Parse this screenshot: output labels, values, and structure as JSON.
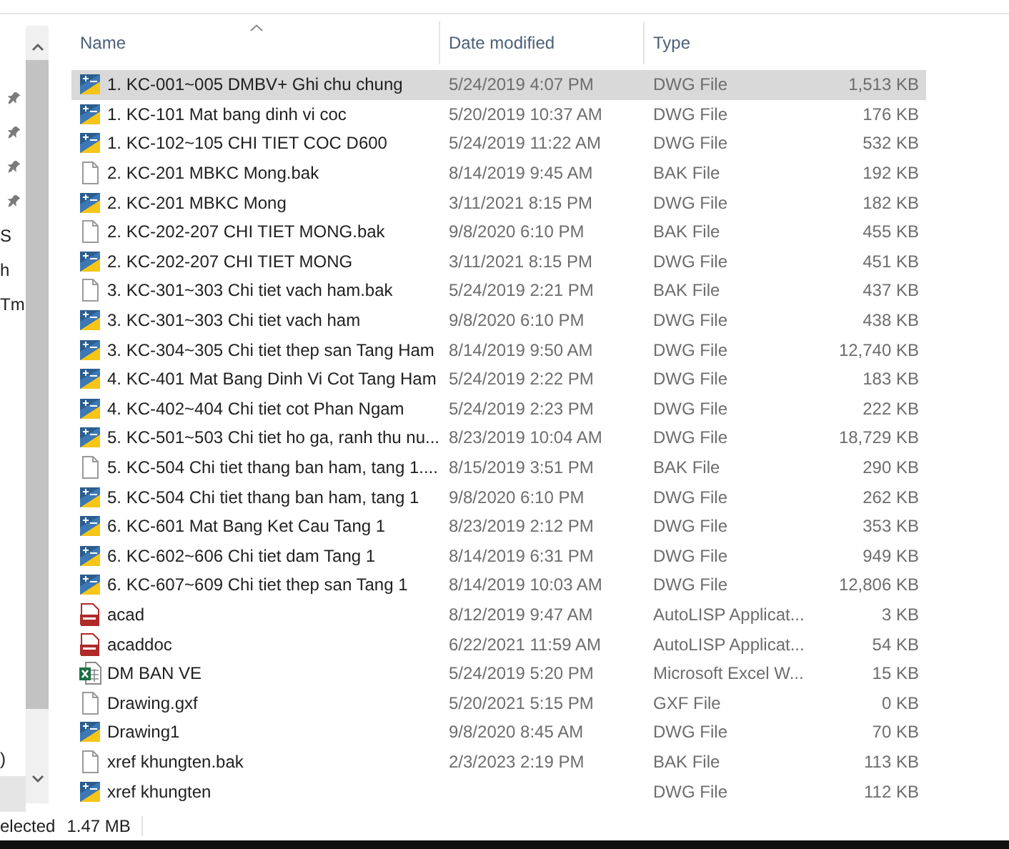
{
  "nav_items": [
    {
      "kind": "pin"
    },
    {
      "kind": "pin"
    },
    {
      "kind": "pin"
    },
    {
      "kind": "pin"
    },
    {
      "kind": "text",
      "label": "S"
    },
    {
      "kind": "text",
      "label": "h"
    },
    {
      "kind": "text",
      "label": "Tm"
    }
  ],
  "nav_items_bottom": [
    {
      "kind": "text",
      "label": ")"
    },
    {
      "kind": "highlight"
    }
  ],
  "table": {
    "columns": [
      {
        "label": "Name",
        "sorted": true
      },
      {
        "label": "Date modified",
        "sorted": false
      },
      {
        "label": "Type",
        "sorted": false
      }
    ],
    "rows": [
      {
        "kind": "dwg",
        "name": "1. KC-001~005 DMBV+ Ghi chu chung",
        "date": "5/24/2019 4:07 PM",
        "type": "DWG File",
        "size": "1,513 KB",
        "selected": true
      },
      {
        "kind": "dwg",
        "name": "1. KC-101 Mat bang dinh vi coc",
        "date": "5/20/2019 10:37 AM",
        "type": "DWG File",
        "size": "176 KB",
        "selected": false
      },
      {
        "kind": "dwg",
        "name": "1. KC-102~105 CHI TIET COC D600",
        "date": "5/24/2019 11:22 AM",
        "type": "DWG File",
        "size": "532 KB",
        "selected": false
      },
      {
        "kind": "doc",
        "name": "2. KC-201 MBKC Mong.bak",
        "date": "8/14/2019 9:45 AM",
        "type": "BAK File",
        "size": "192 KB",
        "selected": false
      },
      {
        "kind": "dwg",
        "name": "2. KC-201 MBKC Mong",
        "date": "3/11/2021 8:15 PM",
        "type": "DWG File",
        "size": "182 KB",
        "selected": false
      },
      {
        "kind": "doc",
        "name": "2. KC-202-207 CHI TIET MONG.bak",
        "date": "9/8/2020 6:10 PM",
        "type": "BAK File",
        "size": "455 KB",
        "selected": false
      },
      {
        "kind": "dwg",
        "name": "2. KC-202-207 CHI TIET MONG",
        "date": "3/11/2021 8:15 PM",
        "type": "DWG File",
        "size": "451 KB",
        "selected": false
      },
      {
        "kind": "doc",
        "name": "3. KC-301~303 Chi tiet vach ham.bak",
        "date": "5/24/2019 2:21 PM",
        "type": "BAK File",
        "size": "437 KB",
        "selected": false
      },
      {
        "kind": "dwg",
        "name": "3. KC-301~303 Chi tiet vach ham",
        "date": "9/8/2020 6:10 PM",
        "type": "DWG File",
        "size": "438 KB",
        "selected": false
      },
      {
        "kind": "dwg",
        "name": "3. KC-304~305 Chi tiet thep san Tang Ham",
        "date": "8/14/2019 9:50 AM",
        "type": "DWG File",
        "size": "12,740 KB",
        "selected": false
      },
      {
        "kind": "dwg",
        "name": "4. KC-401 Mat Bang Dinh Vi Cot Tang Ham",
        "date": "5/24/2019 2:22 PM",
        "type": "DWG File",
        "size": "183 KB",
        "selected": false
      },
      {
        "kind": "dwg",
        "name": "4. KC-402~404 Chi tiet cot Phan Ngam",
        "date": "5/24/2019 2:23 PM",
        "type": "DWG File",
        "size": "222 KB",
        "selected": false
      },
      {
        "kind": "dwg",
        "name": "5. KC-501~503 Chi tiet ho ga, ranh thu nu...",
        "date": "8/23/2019 10:04 AM",
        "type": "DWG File",
        "size": "18,729 KB",
        "selected": false
      },
      {
        "kind": "doc",
        "name": "5. KC-504 Chi tiet thang ban ham, tang 1....",
        "date": "8/15/2019 3:51 PM",
        "type": "BAK File",
        "size": "290 KB",
        "selected": false
      },
      {
        "kind": "dwg",
        "name": "5. KC-504 Chi tiet thang ban ham, tang 1",
        "date": "9/8/2020 6:10 PM",
        "type": "DWG File",
        "size": "262 KB",
        "selected": false
      },
      {
        "kind": "dwg",
        "name": "6. KC-601 Mat Bang Ket Cau Tang 1",
        "date": "8/23/2019 2:12 PM",
        "type": "DWG File",
        "size": "353 KB",
        "selected": false
      },
      {
        "kind": "dwg",
        "name": "6. KC-602~606 Chi tiet dam Tang 1",
        "date": "8/14/2019 6:31 PM",
        "type": "DWG File",
        "size": "949 KB",
        "selected": false
      },
      {
        "kind": "dwg",
        "name": "6. KC-607~609 Chi tiet thep san Tang 1",
        "date": "8/14/2019 10:03 AM",
        "type": "DWG File",
        "size": "12,806 KB",
        "selected": false
      },
      {
        "kind": "lsp",
        "name": "acad",
        "date": "8/12/2019 9:47 AM",
        "type": "AutoLISP Applicat...",
        "size": "3 KB",
        "selected": false
      },
      {
        "kind": "lsp",
        "name": "acaddoc",
        "date": "6/22/2021 11:59 AM",
        "type": "AutoLISP Applicat...",
        "size": "54 KB",
        "selected": false
      },
      {
        "kind": "xls",
        "name": "DM BAN VE",
        "date": "5/24/2019 5:20 PM",
        "type": "Microsoft Excel W...",
        "size": "15 KB",
        "selected": false
      },
      {
        "kind": "doc",
        "name": "Drawing.gxf",
        "date": "5/20/2021 5:15 PM",
        "type": "GXF File",
        "size": "0 KB",
        "selected": false
      },
      {
        "kind": "dwg",
        "name": "Drawing1",
        "date": "9/8/2020 8:45 AM",
        "type": "DWG File",
        "size": "70 KB",
        "selected": false
      },
      {
        "kind": "doc",
        "name": "xref khungten.bak",
        "date": "2/3/2023 2:19 PM",
        "type": "BAK File",
        "size": "113 KB",
        "selected": false
      },
      {
        "kind": "dwg",
        "name": "xref khungten",
        "type": "DWG File",
        "size": "112 KB",
        "selected": false
      }
    ]
  },
  "status_bar": {
    "selection": "elected",
    "size": "1.47 MB"
  }
}
